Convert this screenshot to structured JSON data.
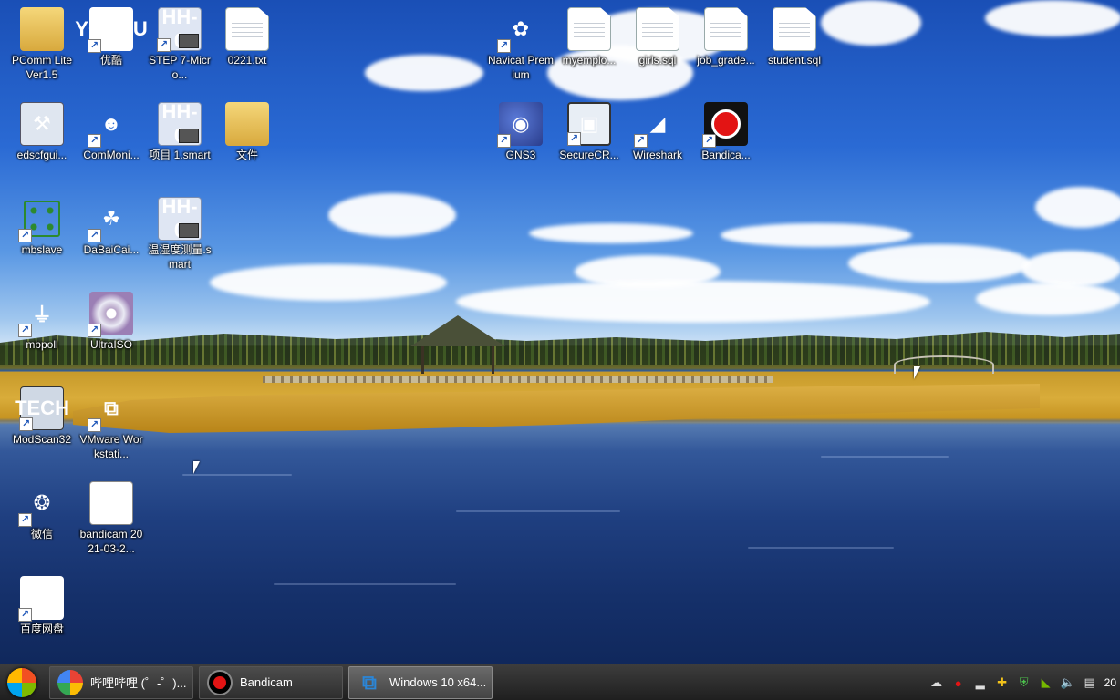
{
  "desktop": {
    "icons": [
      {
        "id": "pcomm",
        "label": "PComm Lite Ver1.5",
        "glyph": "folder-icon"
      },
      {
        "id": "youku",
        "label": "优酷",
        "glyph": "youku-icon"
      },
      {
        "id": "step",
        "label": "STEP 7-Micro...",
        "glyph": "step7-icon"
      },
      {
        "id": "txt0221",
        "label": "0221.txt",
        "glyph": "text-file-icon"
      },
      {
        "id": "navicat",
        "label": "Navicat Premium",
        "glyph": "navicat-icon"
      },
      {
        "id": "myemplo",
        "label": "myemplo...",
        "glyph": "sql-file-icon"
      },
      {
        "id": "girls",
        "label": "girls.sql",
        "glyph": "sql-file-icon"
      },
      {
        "id": "jobgrade",
        "label": "job_grade...",
        "glyph": "sql-file-icon"
      },
      {
        "id": "student",
        "label": "student.sql",
        "glyph": "sql-file-icon"
      },
      {
        "id": "edscf",
        "label": "edscfgui...",
        "glyph": "edscfgui-icon"
      },
      {
        "id": "commoni",
        "label": "ComMoni...",
        "glyph": "commonitor-icon"
      },
      {
        "id": "xiangmu",
        "label": "项目 1.smart",
        "glyph": "step7-icon"
      },
      {
        "id": "wenjian",
        "label": "文件",
        "glyph": "folder-icon"
      },
      {
        "id": "gns3",
        "label": "GNS3",
        "glyph": "gns3-icon"
      },
      {
        "id": "securecrt",
        "label": "SecureCR...",
        "glyph": "securecrt-icon"
      },
      {
        "id": "wireshark",
        "label": "Wireshark",
        "glyph": "wireshark-icon"
      },
      {
        "id": "bandicam",
        "label": "Bandica...",
        "glyph": "bandicam-icon"
      },
      {
        "id": "mbslave",
        "label": "mbslave",
        "glyph": "mbslave-icon"
      },
      {
        "id": "dabai",
        "label": "DaBaiCai...",
        "glyph": "dabaicai-icon"
      },
      {
        "id": "wenshidu",
        "label": "温湿度测量.smart",
        "glyph": "step7-icon"
      },
      {
        "id": "mbpoll",
        "label": "mbpoll",
        "glyph": "mbpoll-icon"
      },
      {
        "id": "ultraiso",
        "label": "UltraISO",
        "glyph": "ultraiso-icon"
      },
      {
        "id": "modscan",
        "label": "ModScan32",
        "glyph": "modscan-icon"
      },
      {
        "id": "vmware",
        "label": "VMware Workstati...",
        "glyph": "vmware-icon"
      },
      {
        "id": "weixin",
        "label": "微信",
        "glyph": "wechat-icon"
      },
      {
        "id": "bandivid",
        "label": "bandicam 2021-03-2...",
        "glyph": "avi-file-icon"
      },
      {
        "id": "baidupan",
        "label": "百度网盘",
        "glyph": "baidu-netdisk-icon"
      }
    ]
  },
  "taskbar": {
    "start_label": "Start",
    "tasks": [
      {
        "label": "哔哩哔哩 (゜-゜)...",
        "icon": "bilibili-icon",
        "active": false
      },
      {
        "label": "Bandicam",
        "icon": "bandicam-icon",
        "active": false
      },
      {
        "label": "Windows 10 x64...",
        "icon": "vmware-icon",
        "active": true
      }
    ],
    "clock": "20"
  }
}
